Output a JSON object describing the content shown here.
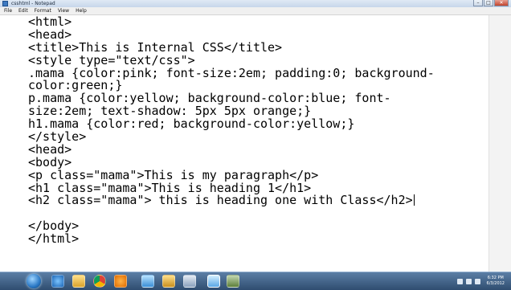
{
  "window": {
    "title": "csshtml - Notepad",
    "menu": [
      "File",
      "Edit",
      "Format",
      "View",
      "Help"
    ],
    "controls": {
      "minimize": "–",
      "maximize": "□",
      "close": "✕"
    }
  },
  "editor": {
    "lines": [
      "<html>",
      "<head>",
      "<title>This is Internal CSS</title>",
      "<style type=\"text/css\">",
      ".mama {color:pink; font-size:2em; padding:0; background-",
      "color:green;}",
      "p.mama {color:yellow; background-color:blue; font-",
      "size:2em; text-shadow: 5px 5px orange;}",
      "h1.mama {color:red; background-color:yellow;}",
      "</style>",
      "<head>",
      "<body>",
      "<p class=\"mama\">This is my paragraph</p>",
      "<h1 class=\"mama\">This is heading 1</h1>",
      "<h2 class=\"mama\"> this is heading one with Class</h2>",
      "",
      "</body>",
      "</html>"
    ]
  },
  "taskbar": {
    "icons": [
      "start-orb",
      "ie-icon",
      "folder-icon",
      "chrome-icon",
      "media-player-icon",
      "network-icon",
      "folder-icon",
      "tool-icon",
      "notepad-icon",
      "app-icon"
    ],
    "clock_time": "6:32 PM",
    "clock_date": "6/3/2012"
  }
}
